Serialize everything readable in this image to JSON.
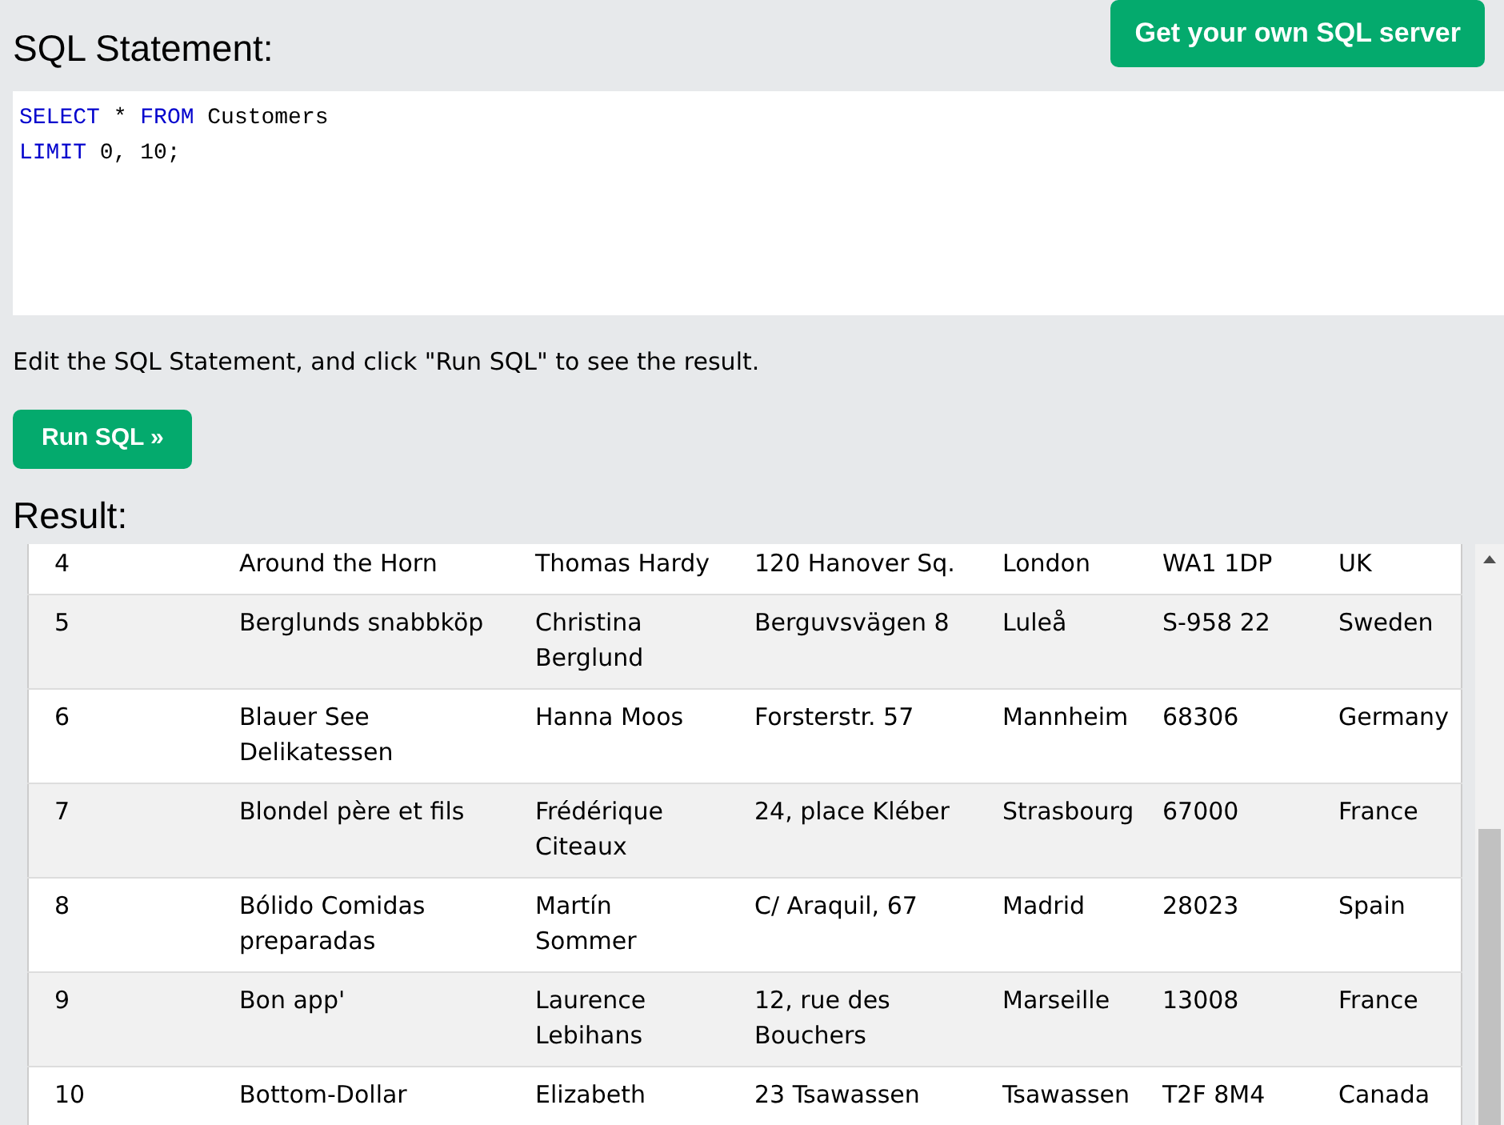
{
  "header": {
    "title": "SQL Statement:",
    "server_button": "Get your own SQL server"
  },
  "sql_editor": {
    "lines": [
      [
        {
          "kind": "keyword",
          "text": "SELECT"
        },
        {
          "kind": "plain",
          "text": " * "
        },
        {
          "kind": "keyword",
          "text": "FROM"
        },
        {
          "kind": "plain",
          "text": " Customers"
        }
      ],
      [
        {
          "kind": "keyword",
          "text": "LIMIT"
        },
        {
          "kind": "plain",
          "text": " 0, 10;"
        }
      ]
    ]
  },
  "instructions": "Edit the SQL Statement, and click \"Run SQL\" to see the result.",
  "run_button": "Run SQL »",
  "result": {
    "title": "Result:",
    "rows": [
      [
        "4",
        "Around the Horn",
        "Thomas Hardy",
        "120 Hanover Sq.",
        "London",
        "WA1 1DP",
        "UK"
      ],
      [
        "5",
        "Berglunds snabbköp",
        "Christina Berglund",
        "Berguvsvägen 8",
        "Luleå",
        "S-958 22",
        "Sweden"
      ],
      [
        "6",
        "Blauer See Delikatessen",
        "Hanna Moos",
        "Forsterstr. 57",
        "Mannheim",
        "68306",
        "Germany"
      ],
      [
        "7",
        "Blondel père et fils",
        "Frédérique Citeaux",
        "24, place Kléber",
        "Strasbourg",
        "67000",
        "France"
      ],
      [
        "8",
        "Bólido Comidas preparadas",
        "Martín Sommer",
        "C/ Araquil, 67",
        "Madrid",
        "28023",
        "Spain"
      ],
      [
        "9",
        "Bon app'",
        "Laurence Lebihans",
        "12, rue des Bouchers",
        "Marseille",
        "13008",
        "France"
      ],
      [
        "10",
        "Bottom-Dollar",
        "Elizabeth",
        "23 Tsawassen",
        "Tsawassen",
        "T2F 8M4",
        "Canada"
      ]
    ]
  }
}
